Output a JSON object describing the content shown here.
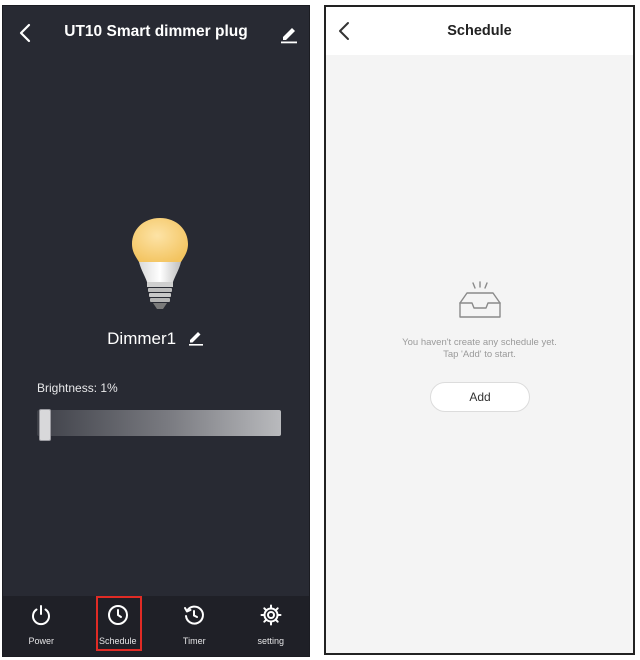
{
  "left_screen": {
    "title": "UT10 Smart dimmer plug",
    "device_name": "Dimmer1",
    "brightness_label": "Brightness: 1%",
    "brightness_percent": 1,
    "nav": {
      "power": "Power",
      "schedule": "Schedule",
      "timer": "Timer",
      "setting": "setting"
    },
    "highlight_color": "#e02b25"
  },
  "right_screen": {
    "title": "Schedule",
    "empty_line1": "You haven't create any schedule yet.",
    "empty_line2": "Tap 'Add' to start.",
    "add_button": "Add"
  },
  "icons": [
    "back-icon",
    "edit-icon",
    "bulb-icon",
    "power-icon",
    "clock-icon",
    "timer-icon",
    "gear-icon",
    "empty-tray-icon"
  ]
}
